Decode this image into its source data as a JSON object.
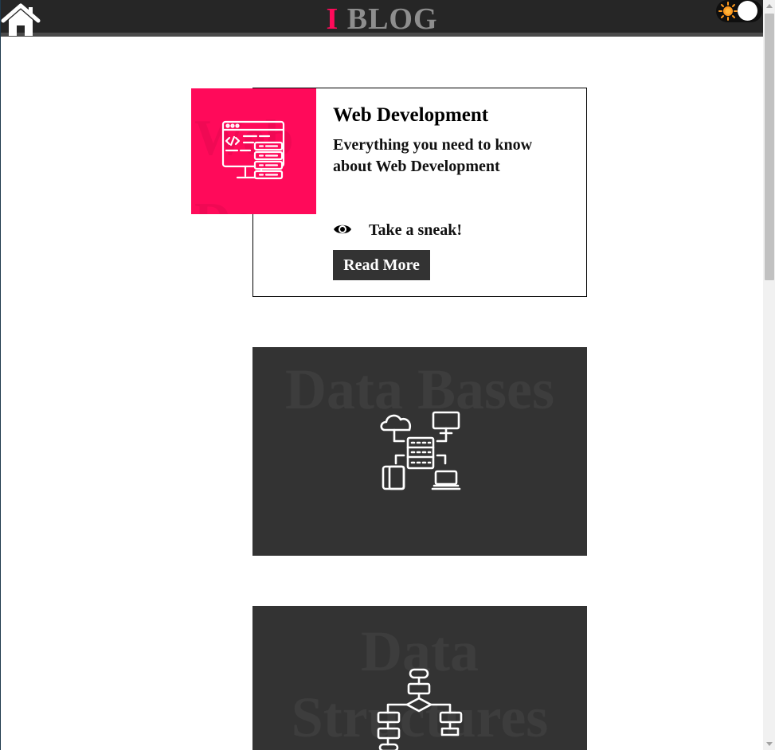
{
  "header": {
    "brand_initial": "I",
    "brand_name": "BLOG",
    "home_icon": "home-icon",
    "theme_toggle": {
      "icon": "sun-icon",
      "state": "light"
    }
  },
  "cards": [
    {
      "bg_word": "Web Dev",
      "title": "Web Development",
      "description": "Everything you need to know about Web Development",
      "sneak_label": "Take a sneak!",
      "sneak_icon": "eye-icon",
      "button_label": "Read More",
      "icon": "web-development-icon",
      "accent": "#ff0a5a"
    },
    {
      "bg_word": "Data Bases",
      "icon": "database-network-icon"
    },
    {
      "bg_word": "Data Structures",
      "icon": "flowchart-icon"
    }
  ],
  "colors": {
    "header_bg": "#262626",
    "accent": "#ff0a5a",
    "brand_gray": "#8e8e8e",
    "card_dark": "#333333"
  }
}
